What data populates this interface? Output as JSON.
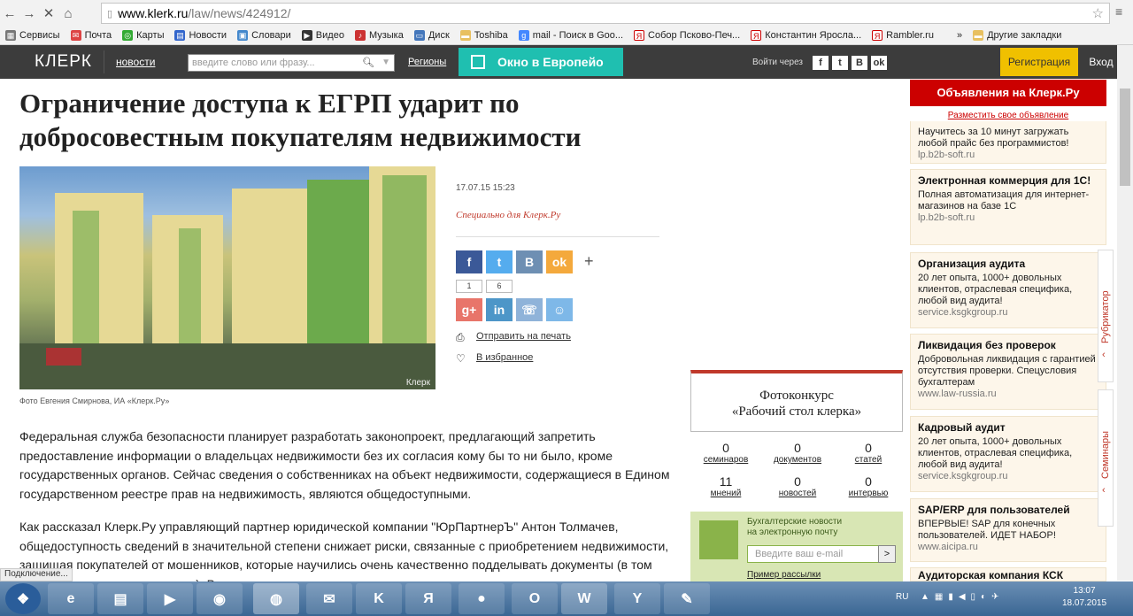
{
  "browser": {
    "url_domain": "www.klerk.ru",
    "url_path": "/law/news/424912/",
    "bookmarks": [
      "Сервисы",
      "Почта",
      "Карты",
      "Новости",
      "Словари",
      "Видео",
      "Музыка",
      "Диск",
      "Toshiba",
      "mail - Поиск в Goo...",
      "Собор Псково-Печ...",
      "Константин Яросла...",
      "Rambler.ru",
      "»",
      "Другие закладки"
    ],
    "status": "Подключение..."
  },
  "site": {
    "logo": "КЛЕРК",
    "nav_news": "новости",
    "search_placeholder": "введите слово или фразу...",
    "regions": "Регионы",
    "window_label": "Окно в Европейо",
    "login_via": "Войти через",
    "social": [
      "f",
      "t",
      "B",
      "ok"
    ],
    "register": "Регистрация",
    "enter": "Вход"
  },
  "article": {
    "title": "Ограничение доступа к ЕГРП ударит по добросовестным покупателям недвижимости",
    "caption": "Фото Евгения Смирнова, ИА «Клерк.Ру»",
    "watermark": "Клерк",
    "date": "17.07.15 15:23",
    "special": "Специально для Клерк.Ру",
    "share_row1": [
      "f",
      "t",
      "B",
      "ok"
    ],
    "share_counts": [
      "1",
      "6"
    ],
    "share_row2": [
      "g+",
      "in",
      "☏",
      "☺"
    ],
    "plus": "+",
    "print": "Отправить на печать",
    "favorite": "В избранное",
    "p1": "Федеральная служба безопасности планирует разработать законопроект, предлагающий запретить предоставление информации о владельцах недвижимости без их согласия кому бы то ни было, кроме государственных органов. Сейчас сведения о собственниках на объект недвижимости, содержащиеся в Едином государственном реестре прав на недвижимость, являются общедоступными.",
    "p2": "Как рассказал Клерк.Ру управляющий партнер юридической компании \"ЮрПартнерЪ\" Антон Толмачев, общедоступность сведений в значительной степени снижает риски, связанные с приобретением недвижимости, защищая покупателей от мошенников, которые научились очень качественно подделывать документы (в том числе правоустанавливающие). В связи с этим"
  },
  "contest": {
    "line1": "Фотоконкурс",
    "line2": "«Рабочий стол клерка»"
  },
  "stats": [
    {
      "n": "0",
      "l": "семинаров"
    },
    {
      "n": "0",
      "l": "документов"
    },
    {
      "n": "0",
      "l": "статей"
    },
    {
      "n": "11",
      "l": "мнений"
    },
    {
      "n": "0",
      "l": "новостей"
    },
    {
      "n": "0",
      "l": "интервью"
    }
  ],
  "subscribe": {
    "line1": "Бухгалтерские новости",
    "line2": "на электронную почту",
    "placeholder": "Введите ваш e-mail",
    "button": ">",
    "sample": "Пример рассылки"
  },
  "ads": {
    "header": "Объявления на Клерк.Ру",
    "place": "Разместить свое объявление",
    "items": [
      {
        "h": "",
        "t": "Научитесь за 10 минут загружать любой прайс без программистов!",
        "u": "lp.b2b-soft.ru"
      },
      {
        "h": "Электронная коммерция для 1С!",
        "t": "Полная автоматизация для интернет-магазинов на базе 1С",
        "u": "lp.b2b-soft.ru"
      },
      {
        "h": "Организация аудита",
        "t": "20 лет опыта, 1000+ довольных клиентов, отраслевая специфика, любой вид аудита!",
        "u": "service.ksgkgroup.ru"
      },
      {
        "h": "Ликвидация без проверок",
        "t": "Добровольная ликвидация с гарантией отсутствия проверки. Спецусловия бухгалтерам",
        "u": "www.law-russia.ru"
      },
      {
        "h": "Кадровый аудит",
        "t": "20 лет опыта, 1000+ довольных клиентов, отраслевая специфика, любой вид аудита!",
        "u": "service.ksgkgroup.ru"
      },
      {
        "h": "SAP/ERP для пользователей",
        "t": "ВПЕРВЫЕ! SAP для конечных пользователей. ИДЕТ НАБОР!",
        "u": "www.aicipa.ru"
      },
      {
        "h": "Аудиторская компания КСК",
        "t": "",
        "u": ""
      }
    ]
  },
  "sidetabs": [
    "Рубрикатор",
    "Семинары"
  ],
  "taskbar": {
    "lang": "RU",
    "time": "13:07",
    "date": "18.07.2015"
  }
}
